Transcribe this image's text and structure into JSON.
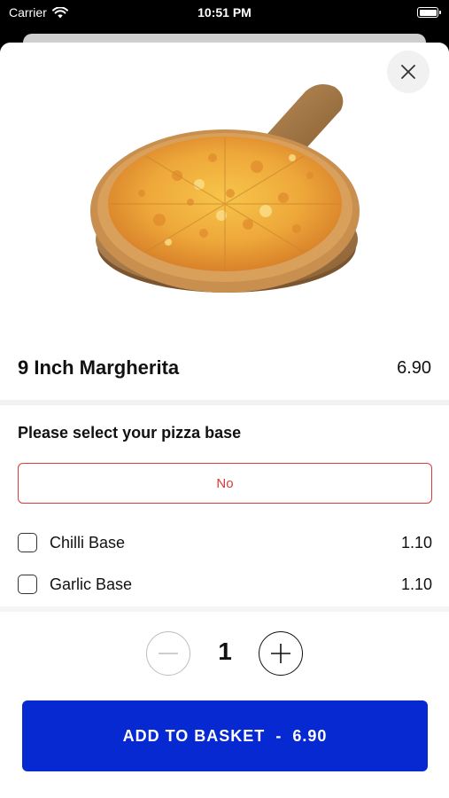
{
  "status_bar": {
    "carrier": "Carrier",
    "time": "10:51 PM"
  },
  "product": {
    "name": "9 Inch Margherita",
    "price": "6.90"
  },
  "base_section": {
    "title": "Please select your pizza base",
    "none_option": "No",
    "options": [
      {
        "label": "Chilli Base",
        "price": "1.10",
        "checked": false
      },
      {
        "label": "Garlic Base",
        "price": "1.10",
        "checked": false
      }
    ]
  },
  "quantity": {
    "value": "1"
  },
  "add_button": {
    "label": "ADD TO BASKET",
    "separator": "-",
    "total": "6.90"
  },
  "colors": {
    "accent_blue": "#0629d2",
    "warning_red": "#d93a3a"
  },
  "icons": {
    "close": "close-icon",
    "minus": "minus-icon",
    "plus": "plus-icon",
    "wifi": "wifi-icon",
    "battery": "battery-icon"
  }
}
